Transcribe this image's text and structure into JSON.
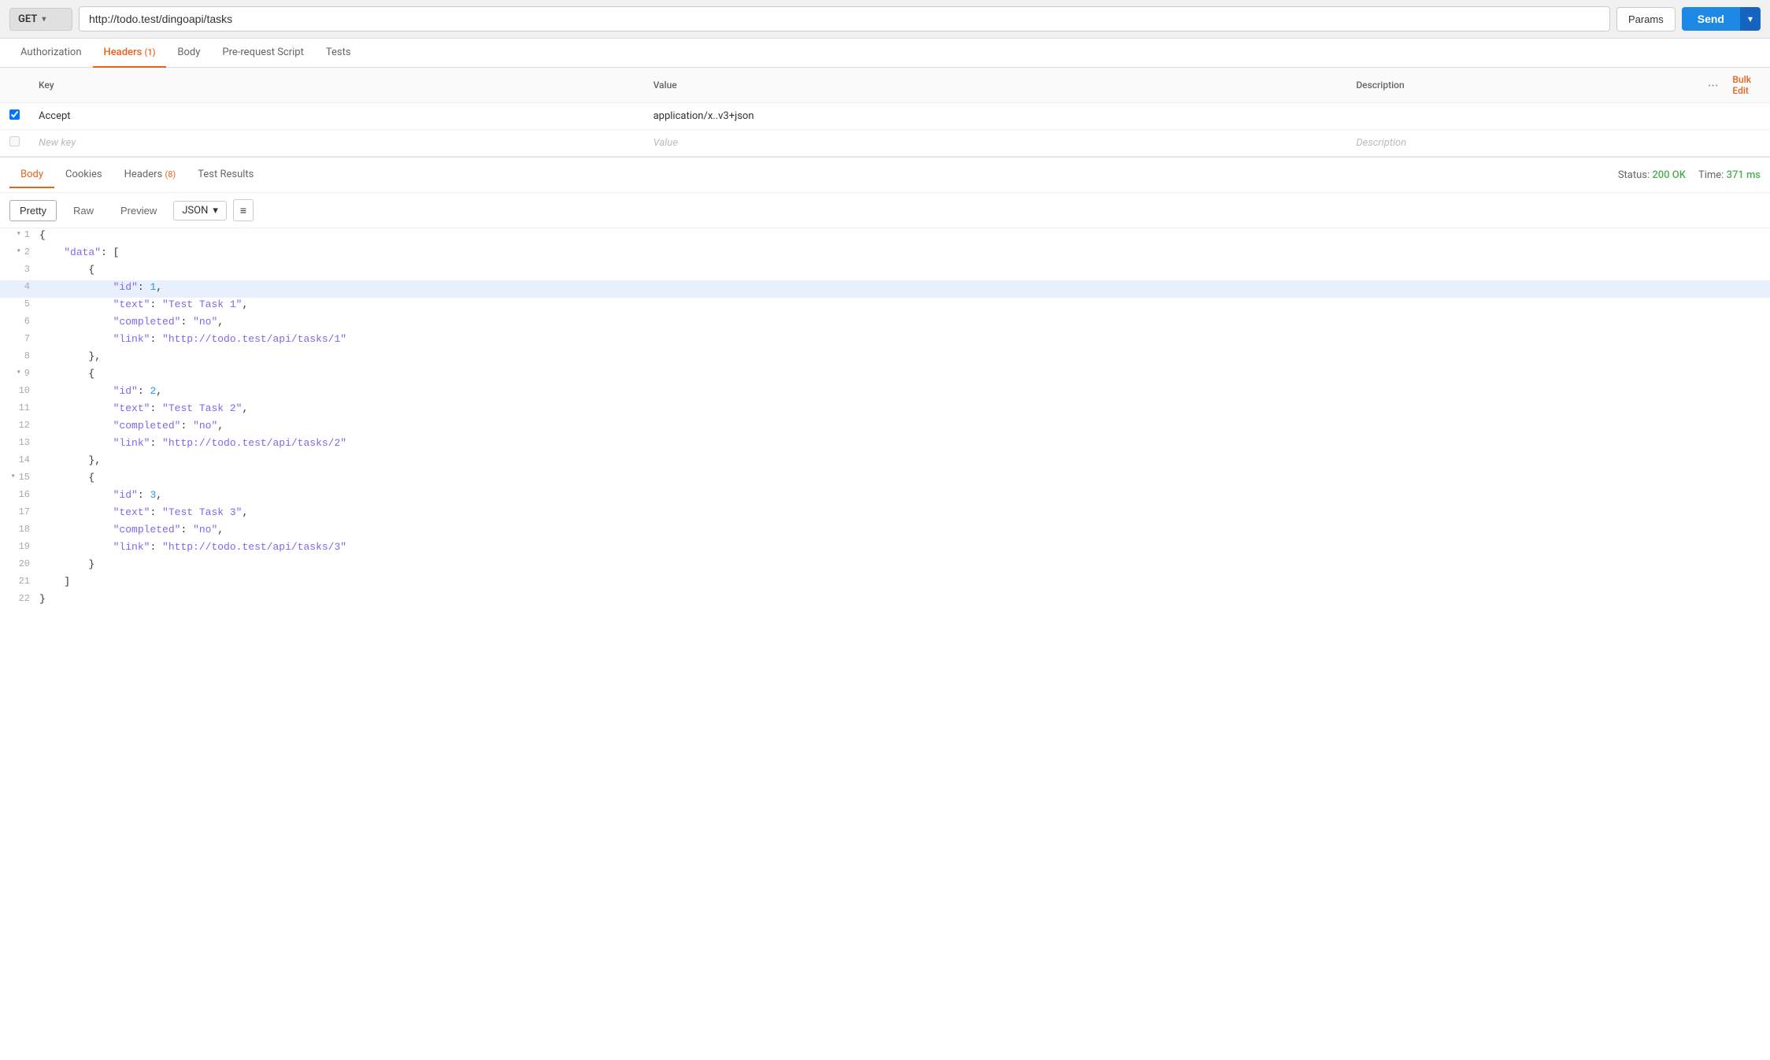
{
  "topbar": {
    "method": "GET",
    "method_chevron": "▾",
    "url": "http://todo.test/dingoapi/tasks",
    "params_label": "Params",
    "send_label": "Send",
    "send_dropdown_icon": "▾"
  },
  "request_tabs": [
    {
      "id": "authorization",
      "label": "Authorization",
      "active": false,
      "badge": null
    },
    {
      "id": "headers",
      "label": "Headers",
      "active": true,
      "badge": "(1)"
    },
    {
      "id": "body",
      "label": "Body",
      "active": false,
      "badge": null
    },
    {
      "id": "prerequest",
      "label": "Pre-request Script",
      "active": false,
      "badge": null
    },
    {
      "id": "tests",
      "label": "Tests",
      "active": false,
      "badge": null
    }
  ],
  "headers_table": {
    "columns": {
      "key": "Key",
      "value": "Value",
      "description": "Description",
      "more": "···",
      "bulk_edit": "Bulk Edit"
    },
    "rows": [
      {
        "checked": true,
        "key": "Accept",
        "value": "application/x..v3+json",
        "description": ""
      }
    ],
    "new_row": {
      "key_placeholder": "New key",
      "value_placeholder": "Value",
      "description_placeholder": "Description"
    }
  },
  "response_tabs": [
    {
      "id": "body",
      "label": "Body",
      "active": true,
      "badge": null
    },
    {
      "id": "cookies",
      "label": "Cookies",
      "active": false,
      "badge": null
    },
    {
      "id": "headers",
      "label": "Headers",
      "active": false,
      "badge": "(8)"
    },
    {
      "id": "test_results",
      "label": "Test Results",
      "active": false,
      "badge": null
    }
  ],
  "response_status": {
    "status_label": "Status:",
    "status_value": "200 OK",
    "time_label": "Time:",
    "time_value": "371 ms"
  },
  "response_toolbar": {
    "views": [
      "Pretty",
      "Raw",
      "Preview"
    ],
    "active_view": "Pretty",
    "format": "JSON",
    "wrap_icon": "≡"
  },
  "response_body": {
    "lines": [
      {
        "num": 1,
        "foldable": true,
        "content": "{",
        "type": "brace",
        "highlighted": false
      },
      {
        "num": 2,
        "foldable": true,
        "content": "    \"data\": [",
        "highlighted": false
      },
      {
        "num": 3,
        "foldable": false,
        "content": "        {",
        "highlighted": false
      },
      {
        "num": 4,
        "foldable": false,
        "content": "            \"id\": 1,",
        "highlighted": true
      },
      {
        "num": 5,
        "foldable": false,
        "content": "            \"text\": \"Test Task 1\",",
        "highlighted": false
      },
      {
        "num": 6,
        "foldable": false,
        "content": "            \"completed\": \"no\",",
        "highlighted": false
      },
      {
        "num": 7,
        "foldable": false,
        "content": "            \"link\": \"http://todo.test/api/tasks/1\"",
        "highlighted": false
      },
      {
        "num": 8,
        "foldable": false,
        "content": "        },",
        "highlighted": false
      },
      {
        "num": 9,
        "foldable": true,
        "content": "        {",
        "highlighted": false
      },
      {
        "num": 10,
        "foldable": false,
        "content": "            \"id\": 2,",
        "highlighted": false
      },
      {
        "num": 11,
        "foldable": false,
        "content": "            \"text\": \"Test Task 2\",",
        "highlighted": false
      },
      {
        "num": 12,
        "foldable": false,
        "content": "            \"completed\": \"no\",",
        "highlighted": false
      },
      {
        "num": 13,
        "foldable": false,
        "content": "            \"link\": \"http://todo.test/api/tasks/2\"",
        "highlighted": false
      },
      {
        "num": 14,
        "foldable": false,
        "content": "        },",
        "highlighted": false
      },
      {
        "num": 15,
        "foldable": true,
        "content": "        {",
        "highlighted": false
      },
      {
        "num": 16,
        "foldable": false,
        "content": "            \"id\": 3,",
        "highlighted": false
      },
      {
        "num": 17,
        "foldable": false,
        "content": "            \"text\": \"Test Task 3\",",
        "highlighted": false
      },
      {
        "num": 18,
        "foldable": false,
        "content": "            \"completed\": \"no\",",
        "highlighted": false
      },
      {
        "num": 19,
        "foldable": false,
        "content": "            \"link\": \"http://todo.test/api/tasks/3\"",
        "highlighted": false
      },
      {
        "num": 20,
        "foldable": false,
        "content": "        }",
        "highlighted": false
      },
      {
        "num": 21,
        "foldable": false,
        "content": "    ]",
        "highlighted": false
      },
      {
        "num": 22,
        "foldable": false,
        "content": "}",
        "highlighted": false
      }
    ]
  }
}
